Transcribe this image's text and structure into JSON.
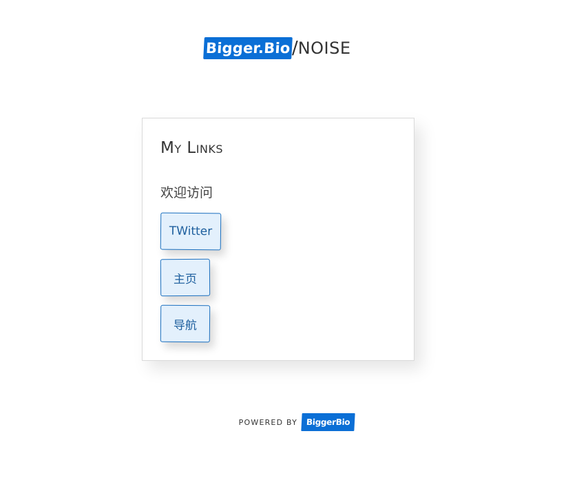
{
  "header": {
    "brand_badge": "Bigger.Bio",
    "separator": "/",
    "site_name": "NOISE"
  },
  "card": {
    "title": "My Links",
    "description": "欢迎访问",
    "links": [
      {
        "label": "TWitter"
      },
      {
        "label": "主页"
      },
      {
        "label": "导航"
      }
    ]
  },
  "footer": {
    "powered_by": "POWERED BY",
    "badge": "BiggerBio"
  },
  "colors": {
    "brand_blue": "#0b6fd6",
    "button_bg": "#e3f0fc",
    "button_border": "#1a6fbf",
    "text_dark": "#333333"
  }
}
